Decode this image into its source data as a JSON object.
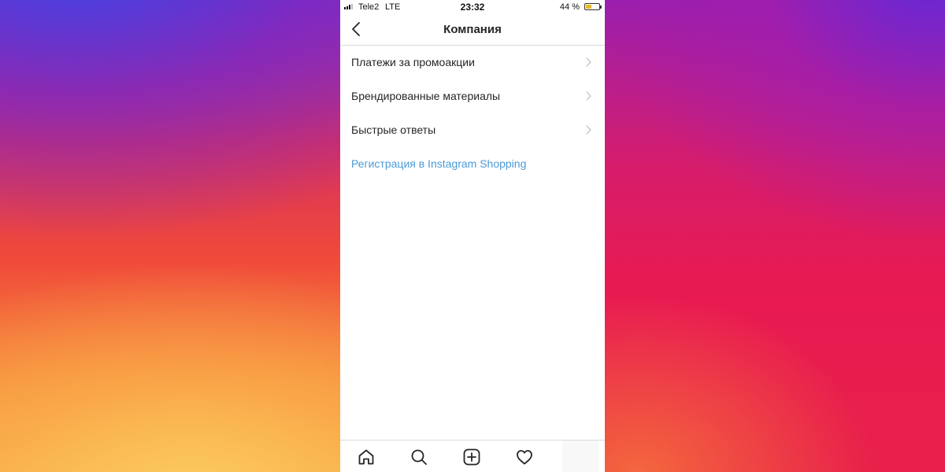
{
  "status_bar": {
    "carrier": "Tele2",
    "network": "LTE",
    "time": "23:32",
    "battery": "44 %",
    "battery_level": 0.44
  },
  "header": {
    "title": "Компания",
    "back_icon": "chevron-left-icon"
  },
  "menu": {
    "items": [
      {
        "label": "Платежи за промоакции",
        "icon": "chevron-right-icon"
      },
      {
        "label": "Брендированные материалы",
        "icon": "chevron-right-icon"
      },
      {
        "label": "Быстрые ответы",
        "icon": "chevron-right-icon"
      }
    ],
    "link": {
      "label": "Регистрация в Instagram Shopping",
      "color": "#4c9bd6"
    }
  },
  "tab_bar": {
    "icons": [
      "home-icon",
      "search-icon",
      "add-post-icon",
      "heart-icon"
    ]
  }
}
